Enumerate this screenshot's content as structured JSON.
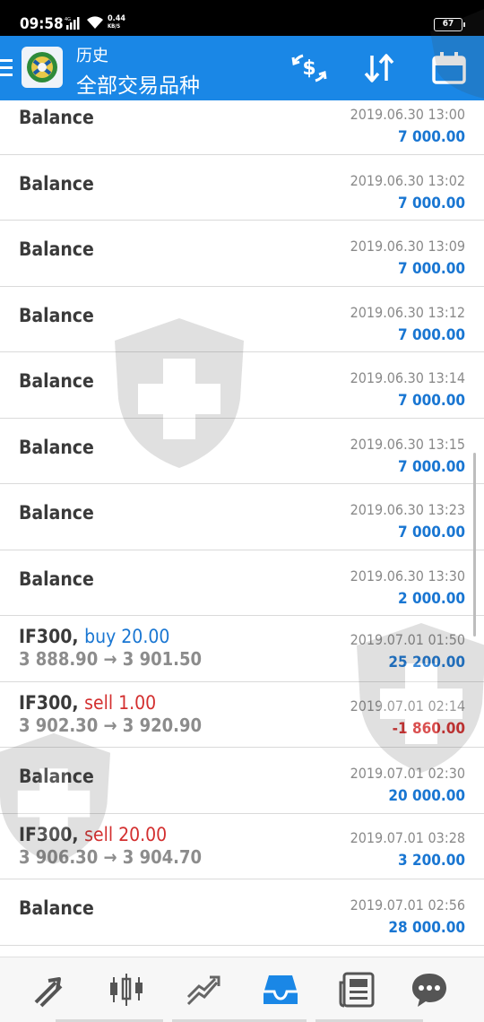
{
  "status_bar": {
    "time": "09:58",
    "network": "4G",
    "speed_value": "0.44",
    "speed_unit": "KB/S",
    "battery": "67"
  },
  "appbar": {
    "title": "历史",
    "subtitle": "全部交易品种",
    "icons": [
      "exchange-dollar-icon",
      "sort-icon",
      "calendar-icon"
    ]
  },
  "history": [
    {
      "title": "Balance",
      "date": "2019.06.30 13:00",
      "amount": "7 000.00"
    },
    {
      "title": "Balance",
      "date": "2019.06.30 13:02",
      "amount": "7 000.00"
    },
    {
      "title": "Balance",
      "date": "2019.06.30 13:09",
      "amount": "7 000.00"
    },
    {
      "title": "Balance",
      "date": "2019.06.30 13:12",
      "amount": "7 000.00"
    },
    {
      "title": "Balance",
      "date": "2019.06.30 13:14",
      "amount": "7 000.00"
    },
    {
      "title": "Balance",
      "date": "2019.06.30 13:15",
      "amount": "7 000.00"
    },
    {
      "title": "Balance",
      "date": "2019.06.30 13:23",
      "amount": "7 000.00"
    },
    {
      "title": "Balance",
      "date": "2019.06.30 13:30",
      "amount": "2 000.00"
    },
    {
      "symbol": "IF300,",
      "type": "buy 20.00",
      "prices": "3 888.90 → 3 901.50",
      "date": "2019.07.01 01:50",
      "amount": "25 200.00"
    },
    {
      "symbol": "IF300,",
      "type": "sell 1.00",
      "prices": "3 902.30 → 3 920.90",
      "date": "2019.07.01 02:14",
      "amount": "-1 860.00"
    },
    {
      "title": "Balance",
      "date": "2019.07.01 02:30",
      "amount": "20 000.00"
    },
    {
      "symbol": "IF300,",
      "type": "sell 20.00",
      "prices": "3 906.30 → 3 904.70",
      "date": "2019.07.01 03:28",
      "amount": "3 200.00"
    },
    {
      "title": "Balance",
      "date": "2019.07.01 02:56",
      "amount": "28 000.00"
    }
  ],
  "colors": {
    "appbar": "#1a87e6",
    "buy": "#1976d2",
    "sell": "#d32f2f",
    "amount_positive": "#1976d2",
    "amount_negative": "#d32f2f",
    "active_tab": "#1a87e6"
  },
  "bottom_nav": {
    "items": [
      "quotes-icon",
      "chart-icon",
      "trade-icon",
      "history-icon",
      "news-icon",
      "chat-icon"
    ],
    "active": "history-icon"
  }
}
